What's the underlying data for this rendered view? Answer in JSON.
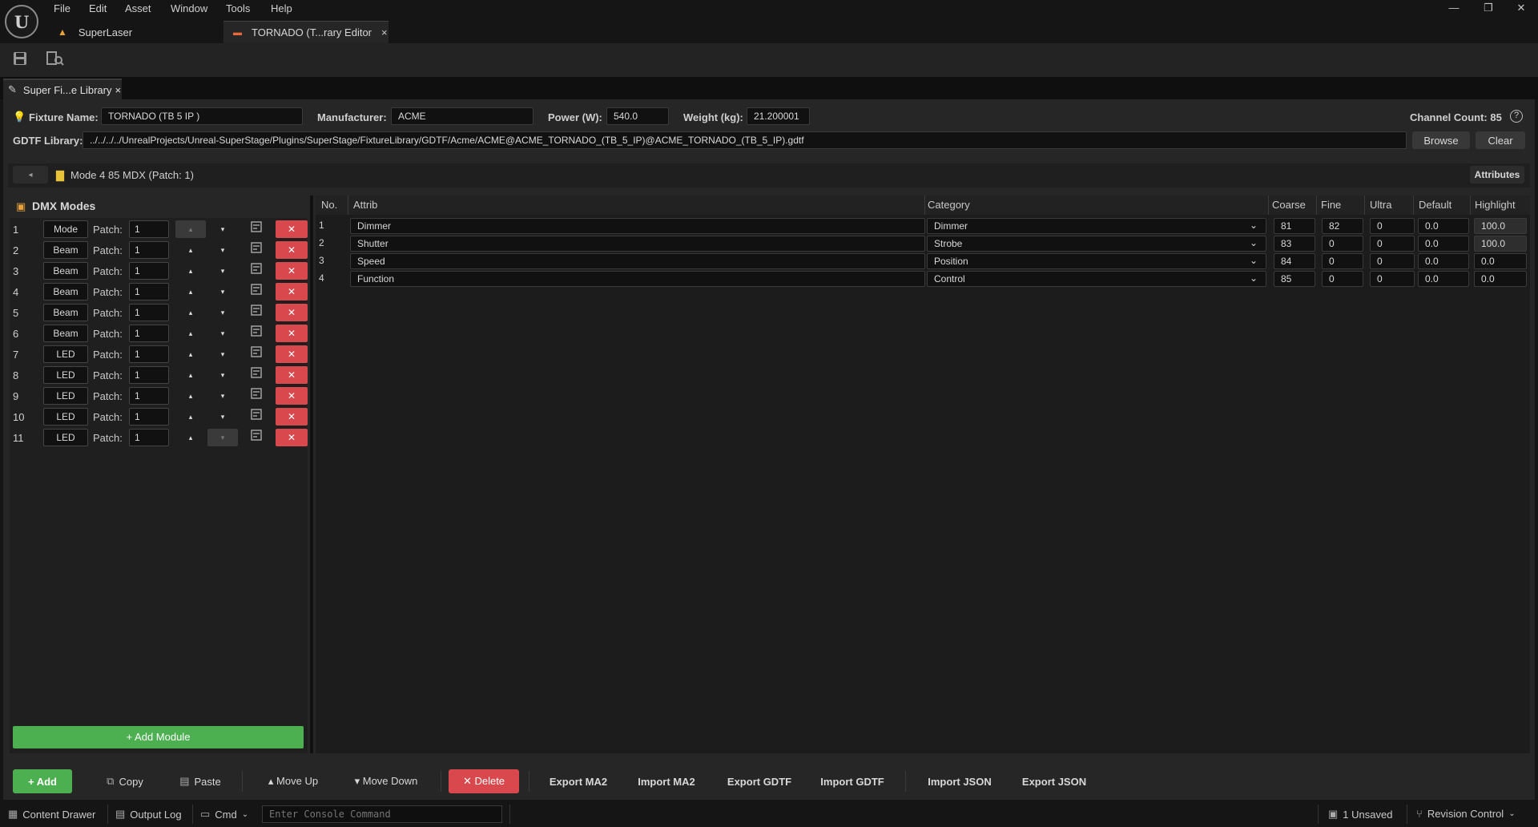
{
  "app": {
    "logo": "unreal-engine-logo",
    "menu": [
      "File",
      "Edit",
      "Asset",
      "Window",
      "Tools",
      "Help"
    ],
    "window_controls": {
      "minimize": "—",
      "restore": "❐",
      "close": "✕"
    },
    "tabs": [
      {
        "label": "SuperLaser",
        "icon": "laser-icon"
      },
      {
        "label": "TORNADO  (T...rary Editor",
        "icon": "fixture-icon",
        "close": "×"
      }
    ]
  },
  "toolbar": {
    "save_icon": "save-icon",
    "browse_icon": "browse-asset-icon"
  },
  "doc_tab": {
    "label": "Super Fi...e Library",
    "close": "×"
  },
  "fixture": {
    "name_label": "Fixture Name:",
    "name_value": "TORNADO  (TB 5 IP )",
    "manufacturer_label": "Manufacturer:",
    "manufacturer_value": "ACME",
    "power_label": "Power (W):",
    "power_value": "540.0",
    "weight_label": "Weight (kg):",
    "weight_value": "21.200001",
    "channel_count": "Channel Count: 85",
    "gdtf_label": "GDTF Library:",
    "gdtf_path": "../../../../UnrealProjects/Unreal-SuperStage/Plugins/SuperStage/FixtureLibrary/GDTF/Acme/ACME@ACME_TORNADO_(TB_5_IP)@ACME_TORNADO_(TB_5_IP).gdtf",
    "browse_label": "Browse",
    "clear_label": "Clear"
  },
  "breadcrumb": {
    "back": "◂",
    "mode_label": "Mode 4 85 MDX (Patch: 1)",
    "attributes_label": "Attributes"
  },
  "dmx_modes": {
    "title": "DMX Modes",
    "patch_label": "Patch:",
    "up": "▴",
    "down": "▾",
    "delete": "✕",
    "rows": [
      {
        "num": "1",
        "name": "Mode",
        "patch": "1"
      },
      {
        "num": "2",
        "name": "Beam",
        "patch": "1"
      },
      {
        "num": "3",
        "name": "Beam",
        "patch": "1"
      },
      {
        "num": "4",
        "name": "Beam",
        "patch": "1"
      },
      {
        "num": "5",
        "name": "Beam",
        "patch": "1"
      },
      {
        "num": "6",
        "name": "Beam",
        "patch": "1"
      },
      {
        "num": "7",
        "name": "LED",
        "patch": "1"
      },
      {
        "num": "8",
        "name": "LED",
        "patch": "1"
      },
      {
        "num": "9",
        "name": "LED",
        "patch": "1"
      },
      {
        "num": "10",
        "name": "LED",
        "patch": "1"
      },
      {
        "num": "11",
        "name": "LED",
        "patch": "1"
      }
    ],
    "add_module": "+ Add Module"
  },
  "table": {
    "headers": [
      "No.",
      "Attrib",
      "Category",
      "Coarse",
      "Fine",
      "Ultra",
      "Default",
      "Highlight"
    ],
    "rows": [
      {
        "no": "1",
        "attrib": "Dimmer",
        "category": "Dimmer",
        "coarse": "81",
        "fine": "82",
        "ultra": "0",
        "default": "0.0",
        "highlight": "100.0"
      },
      {
        "no": "2",
        "attrib": "Shutter",
        "category": "Strobe",
        "coarse": "83",
        "fine": "0",
        "ultra": "0",
        "default": "0.0",
        "highlight": "100.0"
      },
      {
        "no": "3",
        "attrib": "Speed",
        "category": "Position",
        "coarse": "84",
        "fine": "0",
        "ultra": "0",
        "default": "0.0",
        "highlight": "0.0"
      },
      {
        "no": "4",
        "attrib": "Function",
        "category": "Control",
        "coarse": "85",
        "fine": "0",
        "ultra": "0",
        "default": "0.0",
        "highlight": "0.0"
      }
    ]
  },
  "bottom": {
    "add": "+ Add",
    "copy": "Copy",
    "paste": "Paste",
    "move_up": "▴ Move Up",
    "move_down": "▾ Move Down",
    "delete": "✕ Delete",
    "export_ma2": "Export MA2",
    "import_ma2": "Import MA2",
    "export_gdtf": "Export GDTF",
    "import_gdtf": "Import GDTF",
    "import_json": "Import JSON",
    "export_json": "Export JSON"
  },
  "status": {
    "content_drawer": "Content Drawer",
    "output_log": "Output Log",
    "cmd": "Cmd",
    "console_placeholder": "Enter Console Command",
    "unsaved": "1 Unsaved",
    "revision_control": "Revision Control"
  },
  "colors": {
    "accent_green": "#4caf50",
    "delete_red": "#d9484d",
    "folder_yellow": "#e8c33a"
  }
}
